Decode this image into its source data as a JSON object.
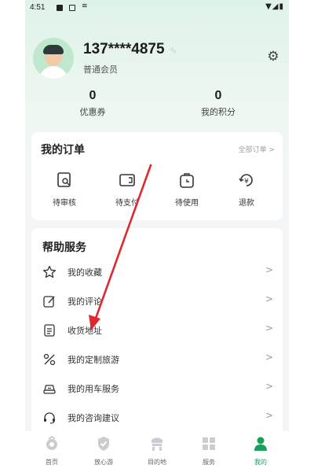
{
  "status_bar": {
    "time": "4:51",
    "right_icons": "▼◢▮"
  },
  "profile": {
    "phone": "137****4875",
    "member_level": "普通会员",
    "stats": [
      {
        "value": "0",
        "label": "优惠券"
      },
      {
        "value": "0",
        "label": "我的积分"
      }
    ]
  },
  "orders": {
    "title": "我的订单",
    "all_link": "全部订单 >",
    "items": [
      {
        "label": "待审核",
        "icon": "pending-review-icon"
      },
      {
        "label": "待支付",
        "icon": "pending-payment-icon"
      },
      {
        "label": "待使用",
        "icon": "pending-use-icon"
      },
      {
        "label": "退款",
        "icon": "refund-icon"
      }
    ]
  },
  "help": {
    "title": "帮助服务",
    "items": [
      {
        "label": "我的收藏",
        "icon": "star-icon"
      },
      {
        "label": "我的评论",
        "icon": "comment-edit-icon"
      },
      {
        "label": "收货地址",
        "icon": "address-doc-icon"
      },
      {
        "label": "我的定制旅游",
        "icon": "custom-travel-icon"
      },
      {
        "label": "我的用车服务",
        "icon": "car-service-icon"
      },
      {
        "label": "我的咨询建议",
        "icon": "headset-icon"
      }
    ],
    "chevron": ">"
  },
  "tabbar": {
    "tabs": [
      {
        "label": "首页",
        "icon": "home-icon"
      },
      {
        "label": "放心游",
        "icon": "shield-check-icon"
      },
      {
        "label": "目的地",
        "icon": "destination-icon"
      },
      {
        "label": "服务",
        "icon": "service-grid-icon"
      },
      {
        "label": "我的",
        "icon": "profile-icon"
      }
    ],
    "active_index": 4
  },
  "colors": {
    "accent": "#16a058",
    "annotation": "#e0282e"
  }
}
